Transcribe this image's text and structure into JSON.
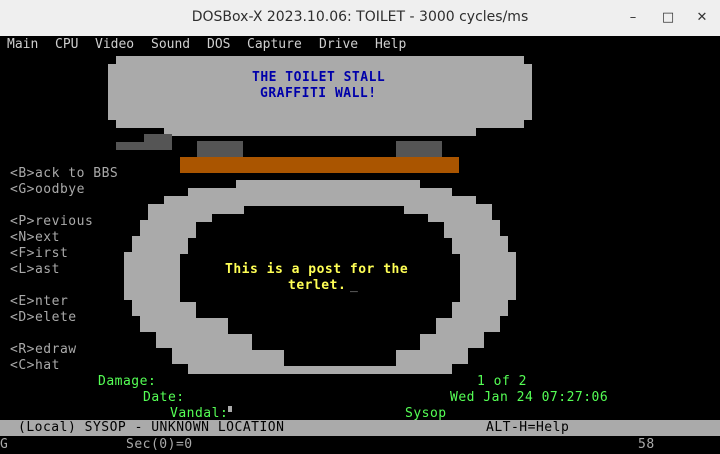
{
  "window": {
    "title": "DOSBox-X 2023.10.06: TOILET - 3000 cycles/ms",
    "minimize_glyph": "–",
    "maximize_glyph": "□",
    "close_glyph": "✕"
  },
  "menubar": [
    "Main",
    "CPU",
    "Video",
    "Sound",
    "DOS",
    "Capture",
    "Drive",
    "Help"
  ],
  "board": {
    "title_line1": "THE TOILET STALL",
    "title_line2": "GRAFFITI WALL!",
    "separator": "________________________________________",
    "post_line1": "This is a post for the",
    "post_line2": "terlet.",
    "cursor": "_"
  },
  "commands": [
    "<B>ack to BBS",
    "<G>oodbye",
    "<P>revious",
    "<N>ext",
    "<F>irst",
    "<L>ast",
    "<E>nter",
    "<D>elete",
    "<R>edraw",
    "<C>hat"
  ],
  "info": {
    "damage_label": "Damage:",
    "damage_value": "1 of 2",
    "date_label": "Date:",
    "date_value": "Wed Jan 24 07:27:06",
    "vandal_label": "Vandal:",
    "vandal_value": "Sysop"
  },
  "status": {
    "left": "(Local) SYSOP - UNKNOWN LOCATION",
    "right": "ALT-H=Help",
    "line2_left": "G",
    "line2_mid": "Sec(0)=0",
    "line2_right": "58"
  },
  "colors": {
    "porcelain": "#aaaaaa",
    "seat": "#aa5500",
    "hinge": "#555555",
    "title_text": "#0000aa",
    "post_text": "#ffff55",
    "info_text": "#55ff55"
  }
}
